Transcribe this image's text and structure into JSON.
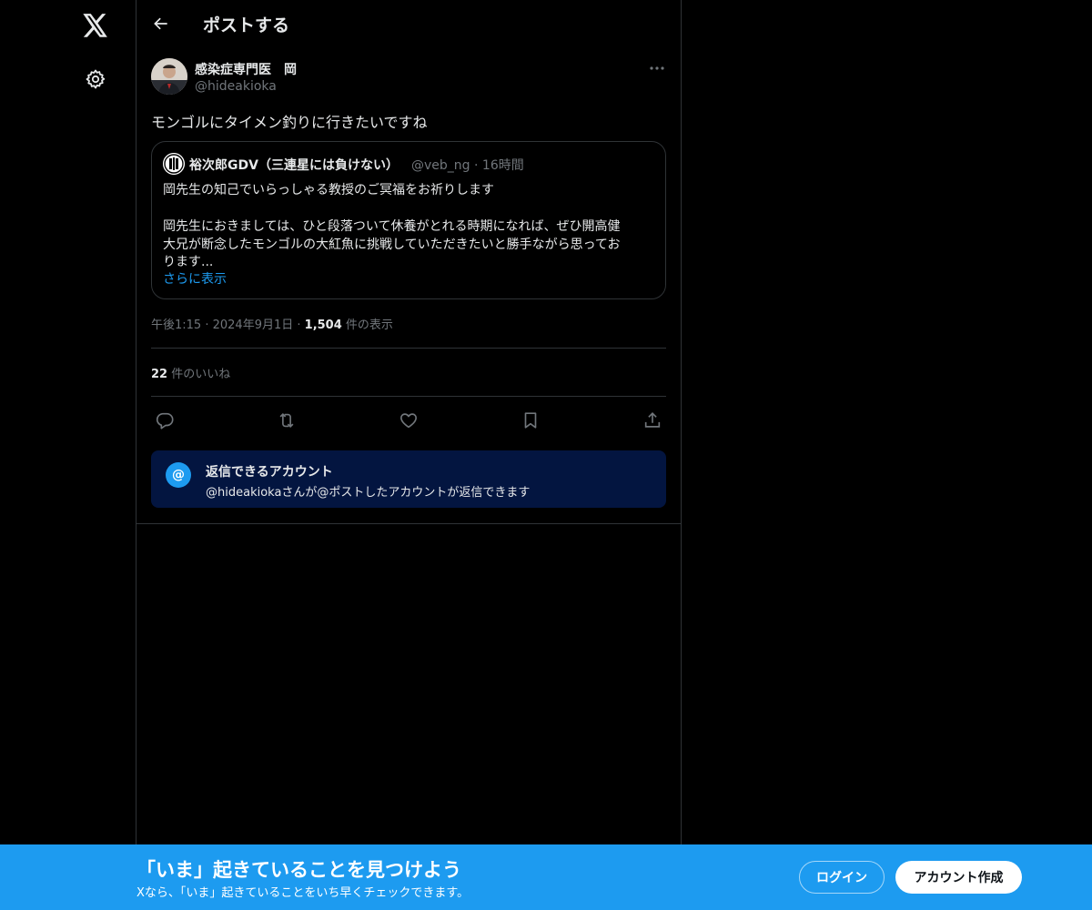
{
  "nav": {
    "logo_icon": "x-logo-icon",
    "settings_icon": "gear-icon"
  },
  "header": {
    "title": "ポストする",
    "back_icon": "arrow-left-icon"
  },
  "post": {
    "author_name": "感染症専門医　岡",
    "author_handle": "@hideakioka",
    "text": "モンゴルにタイメン釣りに行きたいですね",
    "time": "午後1:15",
    "date": "2024年9月1日",
    "views_count": "1,504",
    "views_label": "件の表示",
    "likes_count": "22",
    "likes_label": "件のいいね"
  },
  "quote": {
    "author_name": "裕次郎GDV（三連星には負けない）",
    "author_handle": "@veb_ng",
    "time_ago": "16時間",
    "lines": [
      "岡先生の知己でいらっしゃる教授のご冥福をお祈りします",
      "",
      "岡先生におきましては、ひと段落ついて休養がとれる時期になれば、ぜひ開高健",
      "大兄が断念したモンゴルの大紅魚に挑戦していただきたいと勝手ながら思ってお",
      "ります..."
    ],
    "show_more": "さらに表示"
  },
  "actions": {
    "reply_icon": "reply-icon",
    "repost_icon": "repost-icon",
    "like_icon": "heart-icon",
    "bookmark_icon": "bookmark-icon",
    "share_icon": "share-icon"
  },
  "reply_notice": {
    "icon_glyph": "@",
    "title": "返信できるアカウント",
    "description": "@hideakiokaさんが@ポストしたアカウントが返信できます"
  },
  "banner": {
    "title": "「いま」起きていることを見つけよう",
    "subtitle": "Xなら、「いま」起きていることをいち早くチェックできます。",
    "login_label": "ログイン",
    "signup_label": "アカウント作成"
  },
  "colors": {
    "background": "#000000",
    "text": "#e7e9ea",
    "muted": "#71767b",
    "accent": "#1d9bf0",
    "border": "#2f3336",
    "notice_bg": "#031540"
  }
}
